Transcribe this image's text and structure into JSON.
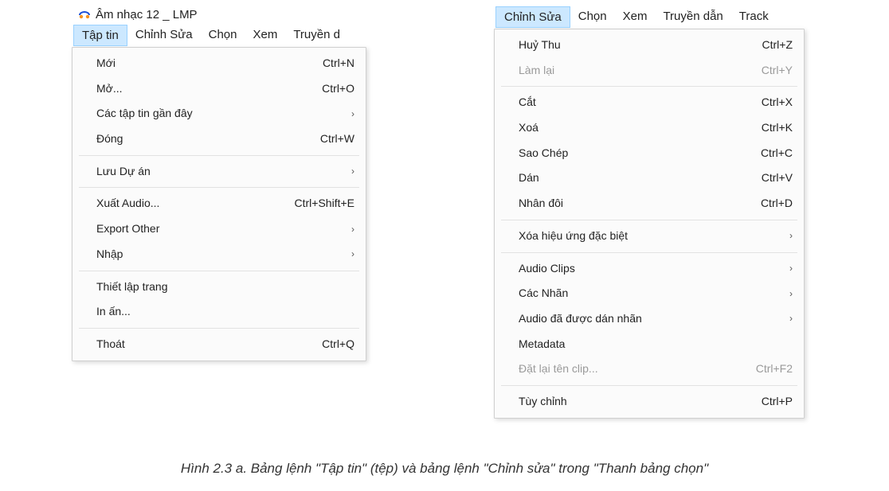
{
  "window_title": "Âm nhạc 12 _ LMP",
  "left_menubar": {
    "items": [
      "Tập tin",
      "Chỉnh Sửa",
      "Chọn",
      "Xem",
      "Truyền d"
    ],
    "active_index": 0
  },
  "right_menubar": {
    "items": [
      "Chỉnh Sửa",
      "Chọn",
      "Xem",
      "Truyền dẫn",
      "Track"
    ],
    "active_index": 0
  },
  "file_menu": [
    {
      "type": "item",
      "label": "Mới",
      "shortcut": "Ctrl+N"
    },
    {
      "type": "item",
      "label": "Mở...",
      "shortcut": "Ctrl+O"
    },
    {
      "type": "item",
      "label": "Các tập tin gần đây",
      "submenu": true
    },
    {
      "type": "item",
      "label": "Đóng",
      "shortcut": "Ctrl+W"
    },
    {
      "type": "separator"
    },
    {
      "type": "item",
      "label": "Lưu Dự án",
      "submenu": true
    },
    {
      "type": "separator"
    },
    {
      "type": "item",
      "label": "Xuất Audio...",
      "shortcut": "Ctrl+Shift+E"
    },
    {
      "type": "item",
      "label": "Export Other",
      "submenu": true
    },
    {
      "type": "item",
      "label": "Nhập",
      "submenu": true
    },
    {
      "type": "separator"
    },
    {
      "type": "item",
      "label": "Thiết lập trang"
    },
    {
      "type": "item",
      "label": "In ấn..."
    },
    {
      "type": "separator"
    },
    {
      "type": "item",
      "label": "Thoát",
      "shortcut": "Ctrl+Q"
    }
  ],
  "edit_menu": [
    {
      "type": "item",
      "label": "Huỷ Thu",
      "shortcut": "Ctrl+Z"
    },
    {
      "type": "item",
      "label": "Làm lại",
      "shortcut": "Ctrl+Y",
      "disabled": true
    },
    {
      "type": "separator"
    },
    {
      "type": "item",
      "label": "Cắt",
      "shortcut": "Ctrl+X"
    },
    {
      "type": "item",
      "label": "Xoá",
      "shortcut": "Ctrl+K"
    },
    {
      "type": "item",
      "label": "Sao Chép",
      "shortcut": "Ctrl+C"
    },
    {
      "type": "item",
      "label": "Dán",
      "shortcut": "Ctrl+V"
    },
    {
      "type": "item",
      "label": "Nhân đôi",
      "shortcut": "Ctrl+D"
    },
    {
      "type": "separator"
    },
    {
      "type": "item",
      "label": "Xóa hiệu ứng đặc biệt",
      "submenu": true
    },
    {
      "type": "separator"
    },
    {
      "type": "item",
      "label": "Audio Clips",
      "submenu": true
    },
    {
      "type": "item",
      "label": "Các Nhãn",
      "submenu": true
    },
    {
      "type": "item",
      "label": "Audio đã được dán nhãn",
      "submenu": true
    },
    {
      "type": "item",
      "label": "Metadata"
    },
    {
      "type": "item",
      "label": "Đặt lại tên clip...",
      "shortcut": "Ctrl+F2",
      "disabled": true
    },
    {
      "type": "separator"
    },
    {
      "type": "item",
      "label": "Tùy chỉnh",
      "shortcut": "Ctrl+P"
    }
  ],
  "caption": "Hình 2.3 a. Bảng lệnh \"Tập tin\" (tệp) và bảng lệnh \"Chỉnh sửa\" trong \"Thanh bảng chọn\""
}
